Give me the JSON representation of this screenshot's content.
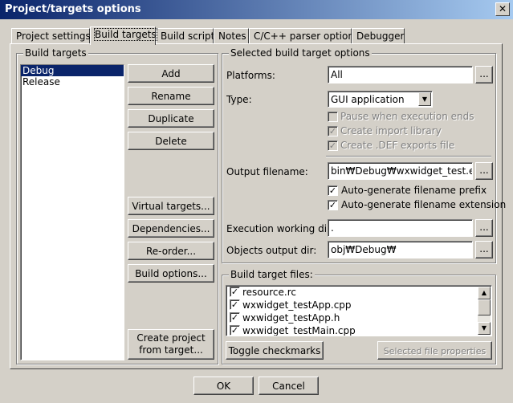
{
  "window": {
    "title": "Project/targets options",
    "close_glyph": "✕"
  },
  "tabs": [
    {
      "label": "Project settings"
    },
    {
      "label": "Build targets",
      "active": true
    },
    {
      "label": "Build scripts"
    },
    {
      "label": "Notes"
    },
    {
      "label": "C/C++ parser options"
    },
    {
      "label": "Debugger"
    }
  ],
  "build_targets": {
    "group_label": "Build targets",
    "items": [
      "Debug",
      "Release"
    ],
    "selected": "Debug",
    "buttons": {
      "add": "Add",
      "rename": "Rename",
      "duplicate": "Duplicate",
      "delete": "Delete",
      "virtual_targets": "Virtual targets...",
      "dependencies": "Dependencies...",
      "reorder": "Re-order...",
      "build_options": "Build options...",
      "create_project_line1": "Create project",
      "create_project_line2": "from target..."
    }
  },
  "selected_options": {
    "group_label": "Selected build target options",
    "platforms_label": "Platforms:",
    "platforms_value": "All",
    "type_label": "Type:",
    "type_value": "GUI application",
    "pause_label": "Pause when execution ends",
    "import_lib_label": "Create import library",
    "def_file_label": "Create .DEF exports file",
    "output_label": "Output filename:",
    "output_value": "bin₩Debug₩wxwidget_test.ex",
    "auto_prefix_label": "Auto-generate filename prefix",
    "auto_ext_label": "Auto-generate filename extension",
    "exec_dir_label": "Execution working dir:",
    "exec_dir_value": ".",
    "obj_dir_label": "Objects output dir:",
    "obj_dir_value": "obj₩Debug₩",
    "browse_label": "..."
  },
  "target_files": {
    "group_label": "Build target files:",
    "files": [
      "resource.rc",
      "wxwidget_testApp.cpp",
      "wxwidget_testApp.h",
      "wxwidget_testMain.cpp"
    ],
    "toggle_label": "Toggle checkmarks",
    "props_label": "Selected file properties"
  },
  "footer": {
    "ok": "OK",
    "cancel": "Cancel"
  },
  "check_glyph": "✓"
}
